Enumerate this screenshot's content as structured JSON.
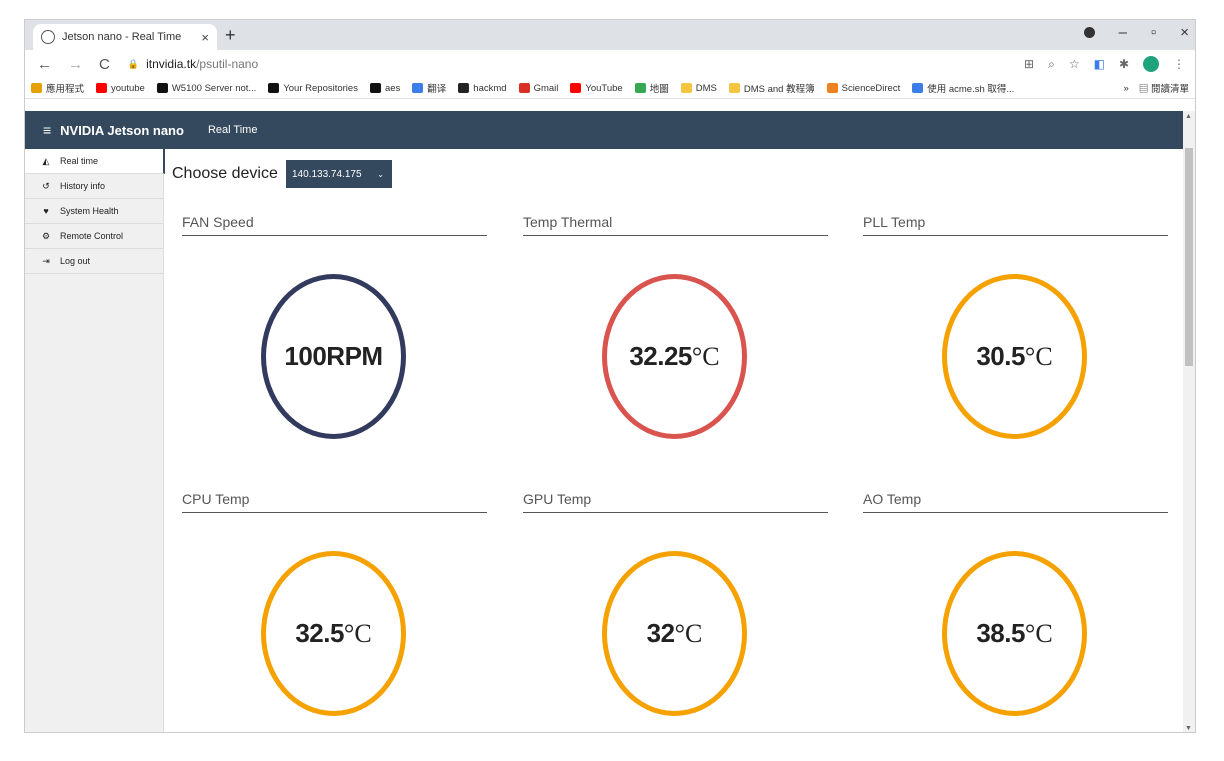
{
  "browser": {
    "tab_title": "Jetson nano - Real Time",
    "tab_close": "×",
    "new_tab": "+",
    "url_host": "itnvidia.tk",
    "url_path": "/psutil-nano",
    "min": "–",
    "max": "▫",
    "close": "×"
  },
  "bookmarks": [
    {
      "label": "應用程式",
      "icon": "apps-icon",
      "color": "#e8a000"
    },
    {
      "label": "youtube",
      "icon": "youtube-icon",
      "color": "#ff0000"
    },
    {
      "label": "W5100 Server not...",
      "icon": "github-icon",
      "color": "#111111"
    },
    {
      "label": "Your Repositories",
      "icon": "github-icon",
      "color": "#111111"
    },
    {
      "label": "aes",
      "icon": "github-icon",
      "color": "#111111"
    },
    {
      "label": "翻译",
      "icon": "translate-icon",
      "color": "#3c7ee8"
    },
    {
      "label": "hackmd",
      "icon": "hackmd-icon",
      "color": "#222222"
    },
    {
      "label": "Gmail",
      "icon": "gmail-icon",
      "color": "#d93025"
    },
    {
      "label": "YouTube",
      "icon": "youtube-icon",
      "color": "#ff0000"
    },
    {
      "label": "地圖",
      "icon": "maps-icon",
      "color": "#34a853"
    },
    {
      "label": "DMS",
      "icon": "folder-icon",
      "color": "#f5c542"
    },
    {
      "label": "DMS and 教程簿",
      "icon": "folder-icon",
      "color": "#f5c542"
    },
    {
      "label": "ScienceDirect",
      "icon": "sciencedirect-icon",
      "color": "#f08020"
    },
    {
      "label": "使用 acme.sh 取得...",
      "icon": "page-icon",
      "color": "#3c7ee8"
    }
  ],
  "bookmarks_more": "»",
  "reading_list": "閱讀清單",
  "app": {
    "brand": "NVIDIA Jetson nano",
    "nav_link": "Real Time",
    "accent": "#34495e",
    "sidebar": [
      {
        "label": "Real time",
        "icon": "area-chart-icon"
      },
      {
        "label": "History info",
        "icon": "history-icon"
      },
      {
        "label": "System Health",
        "icon": "heartbeat-icon"
      },
      {
        "label": "Remote Control",
        "icon": "gears-icon"
      },
      {
        "label": "Log out",
        "icon": "logout-icon"
      }
    ],
    "choose_label": "Choose device",
    "device": "140.133.74.175",
    "gauges": [
      {
        "title": "FAN Speed",
        "value": "100RPM",
        "unit": "",
        "color": "#323a5e"
      },
      {
        "title": "Temp Thermal",
        "value": "32.25",
        "unit": "°C",
        "color": "#d9534f"
      },
      {
        "title": "PLL Temp",
        "value": "30.5",
        "unit": "°C",
        "color": "#f5a100"
      },
      {
        "title": "CPU Temp",
        "value": "32.5",
        "unit": "°C",
        "color": "#f5a100"
      },
      {
        "title": "GPU Temp",
        "value": "32",
        "unit": "°C",
        "color": "#f5a100"
      },
      {
        "title": "AO Temp",
        "value": "38.5",
        "unit": "°C",
        "color": "#f5a100"
      }
    ]
  }
}
